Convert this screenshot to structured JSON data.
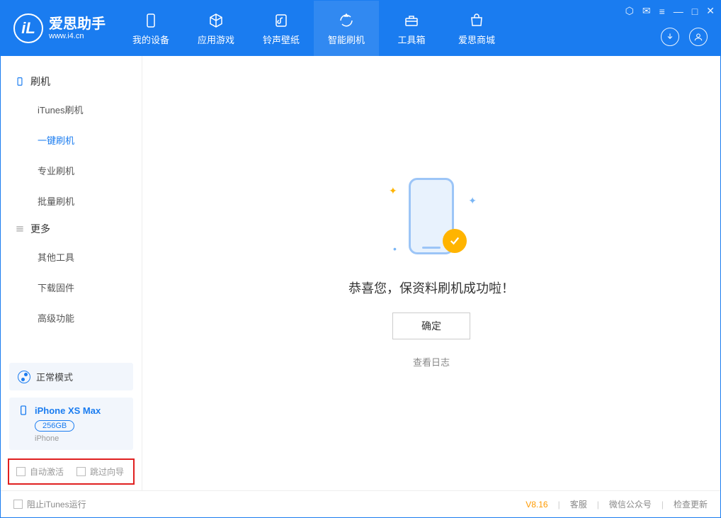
{
  "header": {
    "logo_cn": "爱思助手",
    "logo_en": "www.i4.cn",
    "logo_letter": "iL",
    "tabs": [
      {
        "label": "我的设备",
        "icon": "device-icon"
      },
      {
        "label": "应用游戏",
        "icon": "cube-icon"
      },
      {
        "label": "铃声壁纸",
        "icon": "music-icon"
      },
      {
        "label": "智能刷机",
        "icon": "refresh-icon"
      },
      {
        "label": "工具箱",
        "icon": "toolbox-icon"
      },
      {
        "label": "爱思商城",
        "icon": "store-icon"
      }
    ]
  },
  "sidebar": {
    "group1_title": "刷机",
    "group1_items": [
      "iTunes刷机",
      "一键刷机",
      "专业刷机",
      "批量刷机"
    ],
    "group2_title": "更多",
    "group2_items": [
      "其他工具",
      "下载固件",
      "高级功能"
    ]
  },
  "device": {
    "mode": "正常模式",
    "name": "iPhone XS Max",
    "capacity": "256GB",
    "type": "iPhone"
  },
  "options": {
    "auto_activate": "自动激活",
    "skip_guide": "跳过向导"
  },
  "main": {
    "success_msg": "恭喜您，保资料刷机成功啦！",
    "ok_btn": "确定",
    "log_link": "查看日志"
  },
  "footer": {
    "block_itunes": "阻止iTunes运行",
    "version": "V8.16",
    "support": "客服",
    "wechat": "微信公众号",
    "update": "检查更新"
  }
}
